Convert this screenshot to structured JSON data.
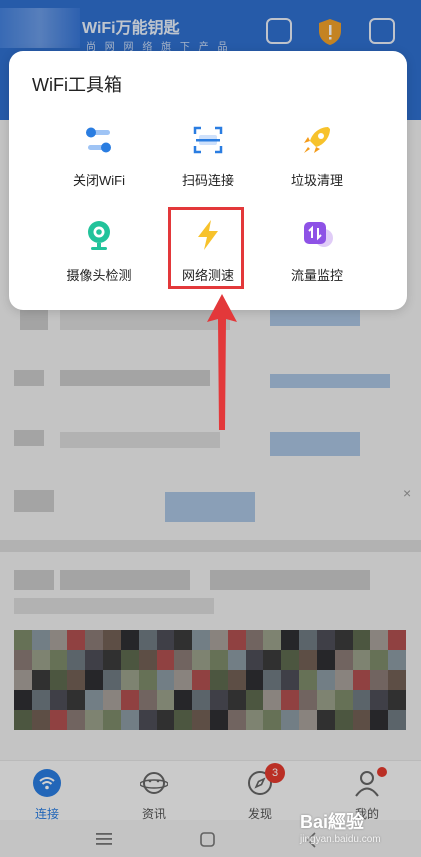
{
  "header": {
    "app_title": "WiFi万能钥匙",
    "app_subtitle": "尚 网 网 络 旗 下 产 品"
  },
  "toolbox": {
    "title": "WiFi工具箱",
    "tools": [
      {
        "label": "关闭WiFi",
        "icon": "toggle-icon"
      },
      {
        "label": "扫码连接",
        "icon": "scan-icon"
      },
      {
        "label": "垃圾清理",
        "icon": "rocket-icon"
      },
      {
        "label": "摄像头检测",
        "icon": "camera-icon"
      },
      {
        "label": "网络测速",
        "icon": "lightning-icon"
      },
      {
        "label": "流量监控",
        "icon": "traffic-icon"
      }
    ],
    "highlighted_tool": "网络测速"
  },
  "bottom_nav": {
    "items": [
      {
        "label": "连接",
        "active": true
      },
      {
        "label": "资讯",
        "active": false
      },
      {
        "label": "发现",
        "badge": "3"
      },
      {
        "label": "我的",
        "dot": true
      }
    ]
  },
  "watermark": {
    "text": "Bai經验",
    "sub": "jingyan.baidu.com"
  },
  "colors": {
    "accent": "#2a7de1",
    "highlight": "#e3383a",
    "badge": "#e33a2e"
  }
}
